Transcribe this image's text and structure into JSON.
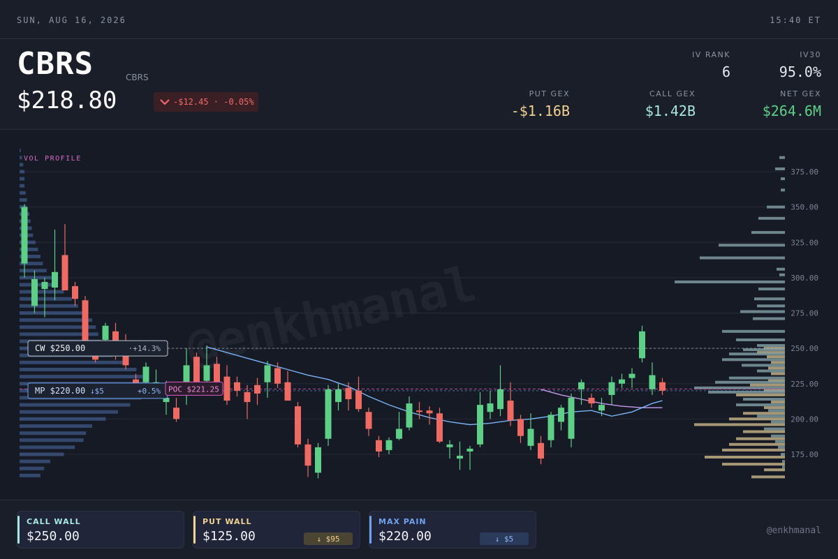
{
  "topbar": {
    "date": "SUN, AUG 16, 2026",
    "time": "15:40 ET"
  },
  "header": {
    "ticker": "CBRS",
    "subtitle": "CBRS",
    "price": "$218.80",
    "change_text": "-$12.45 · -0.05%",
    "change_icon": "chevron-down-icon",
    "iv_rank": {
      "label": "IV RANK",
      "value": "6"
    },
    "iv30": {
      "label": "IV30",
      "value": "95.0%"
    },
    "put_gex": {
      "label": "PUT GEX",
      "value": "-$1.16B"
    },
    "call_gex": {
      "label": "CALL GEX",
      "value": "$1.42B"
    },
    "net_gex": {
      "label": "NET GEX",
      "value": "$264.6M"
    }
  },
  "colors": {
    "up": "#5ecf86",
    "down": "#ef6a62",
    "call": "#a8e8e0",
    "put": "#f2d291",
    "maxpain": "#6fa3f0",
    "ema_fast": "#7ab3f5",
    "ema_slow": "#c79bf0",
    "poc": "#e05cc3",
    "gex_call": "#7e9aa0",
    "gex_put": "#bfae85"
  },
  "chart_data": {
    "type": "candlestick",
    "ylim": [
      157,
      390
    ],
    "yticks": [
      "375.00",
      "350.00",
      "325.00",
      "300.00",
      "275.00",
      "250.00",
      "225.00",
      "200.00",
      "175.00"
    ],
    "vol_profile_label": "VOL PROFILE",
    "candles": [
      {
        "o": 310,
        "h": 352,
        "l": 300,
        "c": 350
      },
      {
        "o": 280,
        "h": 305,
        "l": 275,
        "c": 299
      },
      {
        "o": 292,
        "h": 300,
        "l": 272,
        "c": 297
      },
      {
        "o": 293,
        "h": 334,
        "l": 284,
        "c": 304
      },
      {
        "o": 316,
        "h": 338,
        "l": 295,
        "c": 291
      },
      {
        "o": 294,
        "h": 297,
        "l": 280,
        "c": 285
      },
      {
        "o": 284,
        "h": 287,
        "l": 250,
        "c": 251
      },
      {
        "o": 250,
        "h": 252,
        "l": 240,
        "c": 242
      },
      {
        "o": 256,
        "h": 268,
        "l": 248,
        "c": 266
      },
      {
        "o": 262,
        "h": 268,
        "l": 242,
        "c": 248
      },
      {
        "o": 246,
        "h": 260,
        "l": 235,
        "c": 238
      },
      {
        "o": 228,
        "h": 232,
        "l": 218,
        "c": 219
      },
      {
        "o": 226,
        "h": 240,
        "l": 218,
        "c": 237
      },
      {
        "o": 225,
        "h": 235,
        "l": 215,
        "c": 226
      },
      {
        "o": 212,
        "h": 227,
        "l": 203,
        "c": 215
      },
      {
        "o": 208,
        "h": 215,
        "l": 198,
        "c": 200
      },
      {
        "o": 218,
        "h": 250,
        "l": 210,
        "c": 238
      },
      {
        "o": 244,
        "h": 247,
        "l": 222,
        "c": 226
      },
      {
        "o": 227,
        "h": 252,
        "l": 224,
        "c": 238
      },
      {
        "o": 239,
        "h": 244,
        "l": 218,
        "c": 220
      },
      {
        "o": 230,
        "h": 238,
        "l": 210,
        "c": 213
      },
      {
        "o": 226,
        "h": 230,
        "l": 216,
        "c": 220
      },
      {
        "o": 219,
        "h": 224,
        "l": 200,
        "c": 212
      },
      {
        "o": 224,
        "h": 229,
        "l": 210,
        "c": 218
      },
      {
        "o": 226,
        "h": 241,
        "l": 215,
        "c": 238
      },
      {
        "o": 236,
        "h": 240,
        "l": 222,
        "c": 225
      },
      {
        "o": 226,
        "h": 234,
        "l": 214,
        "c": 213
      },
      {
        "o": 209,
        "h": 212,
        "l": 180,
        "c": 182
      },
      {
        "o": 182,
        "h": 186,
        "l": 159,
        "c": 167
      },
      {
        "o": 162,
        "h": 183,
        "l": 158,
        "c": 180
      },
      {
        "o": 186,
        "h": 224,
        "l": 181,
        "c": 221
      },
      {
        "o": 212,
        "h": 225,
        "l": 206,
        "c": 221
      },
      {
        "o": 222,
        "h": 226,
        "l": 206,
        "c": 214
      },
      {
        "o": 220,
        "h": 230,
        "l": 205,
        "c": 207
      },
      {
        "o": 205,
        "h": 208,
        "l": 188,
        "c": 193
      },
      {
        "o": 185,
        "h": 188,
        "l": 173,
        "c": 177
      },
      {
        "o": 178,
        "h": 187,
        "l": 175,
        "c": 185
      },
      {
        "o": 186,
        "h": 205,
        "l": 185,
        "c": 193
      },
      {
        "o": 194,
        "h": 216,
        "l": 192,
        "c": 211
      },
      {
        "o": 206,
        "h": 212,
        "l": 200,
        "c": 205
      },
      {
        "o": 206,
        "h": 209,
        "l": 196,
        "c": 204
      },
      {
        "o": 204,
        "h": 208,
        "l": 183,
        "c": 184
      },
      {
        "o": 180,
        "h": 185,
        "l": 172,
        "c": 182
      },
      {
        "o": 172,
        "h": 184,
        "l": 164,
        "c": 174
      },
      {
        "o": 177,
        "h": 181,
        "l": 164,
        "c": 179
      },
      {
        "o": 182,
        "h": 219,
        "l": 180,
        "c": 210
      },
      {
        "o": 205,
        "h": 220,
        "l": 200,
        "c": 211
      },
      {
        "o": 207,
        "h": 238,
        "l": 202,
        "c": 221
      },
      {
        "o": 213,
        "h": 226,
        "l": 195,
        "c": 199
      },
      {
        "o": 200,
        "h": 203,
        "l": 183,
        "c": 188
      },
      {
        "o": 181,
        "h": 204,
        "l": 178,
        "c": 193
      },
      {
        "o": 183,
        "h": 188,
        "l": 168,
        "c": 172
      },
      {
        "o": 185,
        "h": 205,
        "l": 180,
        "c": 203
      },
      {
        "o": 198,
        "h": 210,
        "l": 192,
        "c": 208
      },
      {
        "o": 186,
        "h": 218,
        "l": 180,
        "c": 215
      },
      {
        "o": 221,
        "h": 228,
        "l": 210,
        "c": 226
      },
      {
        "o": 215,
        "h": 218,
        "l": 208,
        "c": 211
      },
      {
        "o": 206,
        "h": 215,
        "l": 202,
        "c": 210
      },
      {
        "o": 217,
        "h": 230,
        "l": 210,
        "c": 226
      },
      {
        "o": 225,
        "h": 232,
        "l": 222,
        "c": 228
      },
      {
        "o": 229,
        "h": 236,
        "l": 222,
        "c": 232
      },
      {
        "o": 243,
        "h": 266,
        "l": 240,
        "c": 262
      },
      {
        "o": 221,
        "h": 240,
        "l": 217,
        "c": 231
      },
      {
        "o": 226,
        "h": 229,
        "l": 217,
        "c": 220
      }
    ],
    "ema_fast": [
      [
        18,
        251
      ],
      [
        20,
        247
      ],
      [
        22,
        243
      ],
      [
        24,
        239
      ],
      [
        26,
        235
      ],
      [
        28,
        231
      ],
      [
        30,
        228
      ],
      [
        32,
        223
      ],
      [
        34,
        216
      ],
      [
        36,
        210
      ],
      [
        38,
        205
      ],
      [
        40,
        201
      ],
      [
        42,
        198
      ],
      [
        44,
        196
      ],
      [
        46,
        197
      ],
      [
        48,
        199
      ],
      [
        50,
        200
      ],
      [
        52,
        202
      ],
      [
        54,
        205
      ],
      [
        56,
        206
      ],
      [
        58,
        202
      ],
      [
        60,
        205
      ],
      [
        62,
        211
      ],
      [
        63,
        213
      ]
    ],
    "ema_slow": [
      [
        51,
        221
      ],
      [
        53,
        217
      ],
      [
        55,
        214
      ],
      [
        57,
        211
      ],
      [
        59,
        209
      ],
      [
        61,
        208
      ],
      [
        63,
        208
      ]
    ],
    "vol_profile": [
      [
        390,
        2
      ],
      [
        385,
        4
      ],
      [
        380,
        6
      ],
      [
        375,
        8
      ],
      [
        370,
        8
      ],
      [
        365,
        8
      ],
      [
        360,
        10
      ],
      [
        355,
        12
      ],
      [
        350,
        12
      ],
      [
        345,
        16
      ],
      [
        340,
        18
      ],
      [
        335,
        20
      ],
      [
        330,
        22
      ],
      [
        325,
        26
      ],
      [
        320,
        30
      ],
      [
        315,
        34
      ],
      [
        310,
        38
      ],
      [
        305,
        44
      ],
      [
        300,
        52
      ],
      [
        295,
        60
      ],
      [
        290,
        72
      ],
      [
        285,
        85
      ],
      [
        280,
        95
      ],
      [
        275,
        110
      ],
      [
        270,
        118
      ],
      [
        265,
        124
      ],
      [
        260,
        128
      ],
      [
        255,
        132
      ],
      [
        250,
        140
      ],
      [
        245,
        152
      ],
      [
        240,
        170
      ],
      [
        235,
        190
      ],
      [
        230,
        200
      ],
      [
        225,
        210
      ],
      [
        220,
        208
      ],
      [
        215,
        198
      ],
      [
        210,
        180
      ],
      [
        205,
        160
      ],
      [
        200,
        140
      ],
      [
        195,
        118
      ],
      [
        190,
        108
      ],
      [
        185,
        104
      ],
      [
        180,
        90
      ],
      [
        175,
        72
      ],
      [
        170,
        50
      ],
      [
        165,
        40
      ],
      [
        160,
        34
      ]
    ],
    "gex_bars": [
      {
        "p": 385,
        "call": 8,
        "put": 0
      },
      {
        "p": 377,
        "call": 14,
        "put": 0
      },
      {
        "p": 370,
        "call": 6,
        "put": 0
      },
      {
        "p": 362,
        "call": 6,
        "put": 0
      },
      {
        "p": 350,
        "call": 26,
        "put": 0
      },
      {
        "p": 342,
        "call": 38,
        "put": 0
      },
      {
        "p": 332,
        "call": 48,
        "put": 0
      },
      {
        "p": 323,
        "call": 95,
        "put": 0
      },
      {
        "p": 314,
        "call": 122,
        "put": 0
      },
      {
        "p": 306,
        "call": 12,
        "put": 0
      },
      {
        "p": 302,
        "call": 8,
        "put": 0
      },
      {
        "p": 297,
        "call": 158,
        "put": 0
      },
      {
        "p": 292,
        "call": 38,
        "put": 0
      },
      {
        "p": 285,
        "call": 44,
        "put": 0
      },
      {
        "p": 280,
        "call": 40,
        "put": 0
      },
      {
        "p": 276,
        "call": 64,
        "put": 0
      },
      {
        "p": 271,
        "call": 46,
        "put": 0
      },
      {
        "p": 262,
        "call": 90,
        "put": 0
      },
      {
        "p": 256,
        "call": 70,
        "put": 0
      },
      {
        "p": 252,
        "call": 40,
        "put": 30
      },
      {
        "p": 249,
        "call": 60,
        "put": 40
      },
      {
        "p": 246,
        "call": 80,
        "put": 26
      },
      {
        "p": 242,
        "call": 90,
        "put": 20
      },
      {
        "p": 238,
        "call": 62,
        "put": 24
      },
      {
        "p": 234,
        "call": 40,
        "put": 20
      },
      {
        "p": 229,
        "call": 80,
        "put": 24
      },
      {
        "p": 226,
        "call": 100,
        "put": 50
      },
      {
        "p": 222,
        "call": 130,
        "put": 30
      },
      {
        "p": 219,
        "call": 110,
        "put": 70
      },
      {
        "p": 214,
        "call": 60,
        "put": 20
      },
      {
        "p": 210,
        "call": 70,
        "put": 30
      },
      {
        "p": 206,
        "call": 24,
        "put": 60
      },
      {
        "p": 202,
        "call": 40,
        "put": 80
      },
      {
        "p": 198,
        "call": 20,
        "put": 130
      },
      {
        "p": 193,
        "call": 30,
        "put": 60
      },
      {
        "p": 188,
        "call": 20,
        "put": 70
      },
      {
        "p": 184,
        "call": 14,
        "put": 80
      },
      {
        "p": 180,
        "call": 10,
        "put": 90
      },
      {
        "p": 175,
        "call": 6,
        "put": 115
      },
      {
        "p": 170,
        "call": 4,
        "put": 90
      },
      {
        "p": 166,
        "call": 4,
        "put": 30
      },
      {
        "p": 161,
        "call": 0,
        "put": 48
      }
    ],
    "levels": {
      "call_wall": {
        "price": 250,
        "tag": "CW $250.00",
        "pct": "+14.3%"
      },
      "max_pain": {
        "price": 220,
        "tag": "MP $220.00",
        "delta": "↓$5",
        "pct": "+0.5%"
      },
      "poc": {
        "price": 221.25,
        "tag": "POC $221.25"
      }
    },
    "watermark": "@enkhmanal"
  },
  "footer": {
    "call_wall": {
      "label": "CALL WALL",
      "value": "$250.00"
    },
    "put_wall": {
      "label": "PUT WALL",
      "value": "$125.00",
      "chip": "↓ $95"
    },
    "max_pain": {
      "label": "MAX PAIN",
      "value": "$220.00",
      "chip": "↓ $5"
    },
    "handle": "@enkhmanal"
  }
}
